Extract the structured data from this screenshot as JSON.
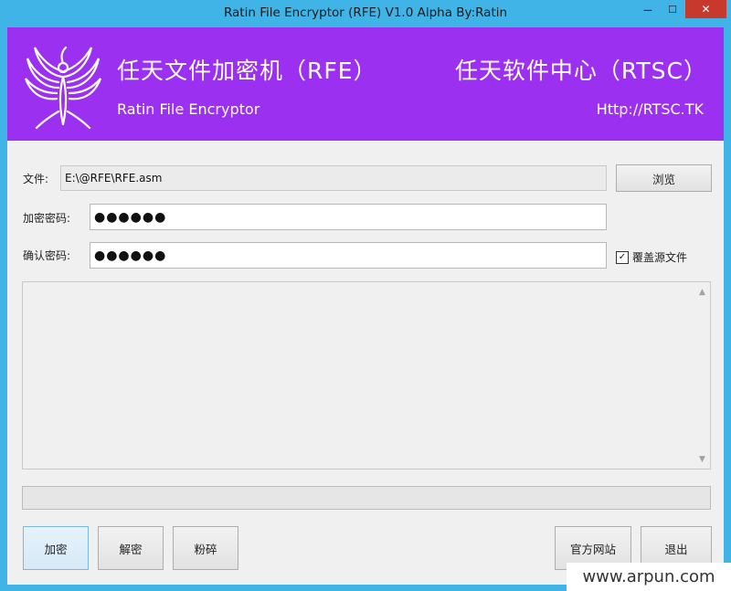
{
  "window": {
    "title": "Ratin File Encryptor (RFE) V1.0 Alpha    By:Ratin",
    "controls": {
      "minimize": "‒",
      "maximize": "☐",
      "close": "✕"
    }
  },
  "banner": {
    "cn_title": "任天文件加密机（RFE）",
    "en_title": "Ratin File Encryptor",
    "center_title": "任天软件中心（RTSC）",
    "url": "Http://RTSC.TK",
    "background": "#9b30f0"
  },
  "form": {
    "file_label": "文件:",
    "file_value": "E:\\@RFE\\RFE.asm",
    "browse_label": "浏览",
    "password_label": "加密密码:",
    "password_value": "●●●●●●",
    "confirm_label": "确认密码:",
    "confirm_value": "●●●●●●",
    "overwrite_label": "覆盖源文件",
    "overwrite_checked": "✓"
  },
  "log": {
    "scroll_up": "▲",
    "scroll_down": "▼"
  },
  "progress": {
    "value": 0
  },
  "buttons": {
    "encrypt": "加密",
    "decrypt": "解密",
    "shred": "粉碎",
    "website": "官方网站",
    "exit": "退出"
  },
  "watermark": "www.arpun.com",
  "colors": {
    "frame": "#40b4e6",
    "banner": "#9b30f0",
    "close": "#c7392c"
  }
}
